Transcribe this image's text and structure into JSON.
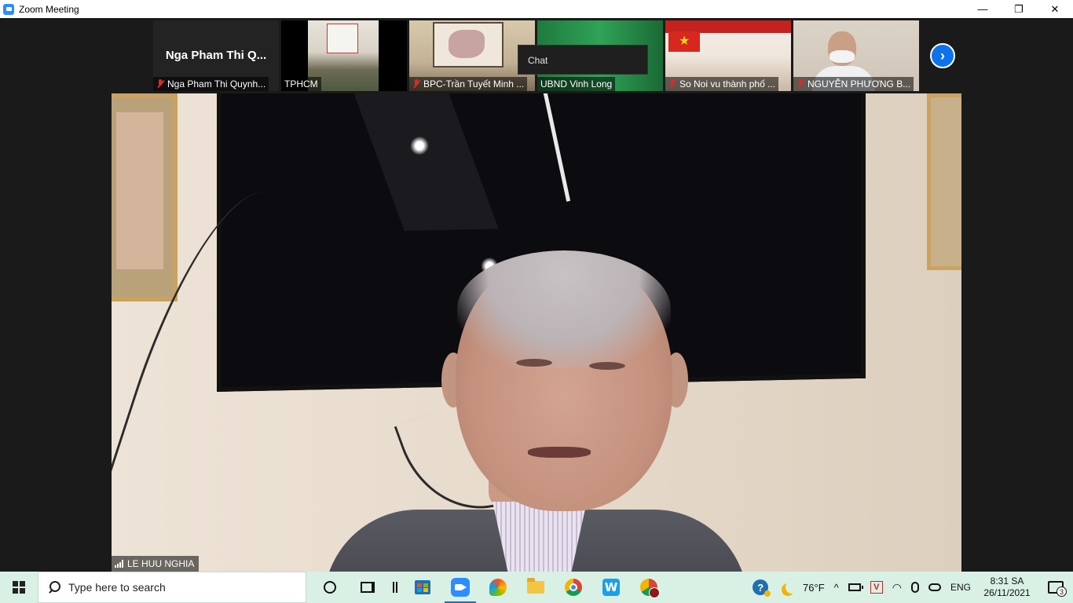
{
  "window": {
    "title": "Zoom Meeting",
    "minimize": "—",
    "restore": "❐",
    "close": "✕"
  },
  "gallery": {
    "tiles": [
      {
        "big_name": "Nga Pham Thi Q...",
        "label": "Nga Pham Thi Quynh...",
        "muted": true
      },
      {
        "label": "TPHCM",
        "muted": false
      },
      {
        "label": "BPC-Trần Tuyết Minh ...",
        "muted": true
      },
      {
        "label": "UBND Vinh Long",
        "muted": false
      },
      {
        "label": "So Noi vu thành phố ...",
        "muted": true
      },
      {
        "label": "NGUYỄN PHƯƠNG B...",
        "muted": true
      }
    ],
    "next_label": "›"
  },
  "chat_tooltip": {
    "text": "Chat"
  },
  "main_video": {
    "speaker_name": "LE HUU NGHIA"
  },
  "taskbar": {
    "search_placeholder": "Type here to search",
    "weather": "76°F",
    "language": "ENG",
    "time": "8:31 SA",
    "date": "26/11/2021",
    "notifications_count": "3",
    "chevron": "^",
    "v_label": "V",
    "wapp_label": "W",
    "help_label": "?"
  },
  "colors": {
    "zoom_blue": "#2d8cff",
    "next_button": "#0e72ed",
    "taskbar_bg": "#d9f0e5",
    "muted_red": "#e02828"
  }
}
